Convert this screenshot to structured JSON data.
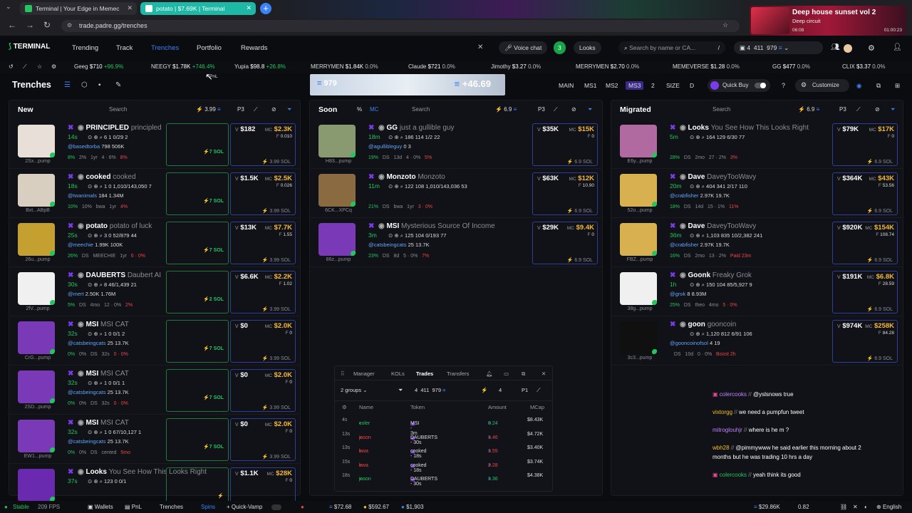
{
  "browser": {
    "tabs": [
      {
        "title": "Terminal | Your Edge in Memec",
        "active": false
      },
      {
        "title": "potato | $7.69K | Terminal",
        "active": true
      }
    ],
    "url": "trade.padre.gg/trenches",
    "media": {
      "title": "Deep house sunset vol 2",
      "artist": "Deep circuit",
      "elapsed": "06:08",
      "duration": "01:00:23"
    }
  },
  "nav": {
    "logo": "TERMINAL",
    "links": [
      "Trending",
      "Track",
      "Trenches",
      "Portfolio",
      "Rewards"
    ],
    "active": "Trenches",
    "voice_chat": "Voice chat",
    "looks_count": "3",
    "looks_label": "Looks",
    "search_placeholder": "Search by name or CA...",
    "search_shortcut": "/",
    "wallet": {
      "count": "4",
      "v1": "411",
      "v2": "979"
    }
  },
  "ticker": [
    {
      "name": "Geeg",
      "mc": "$710",
      "change": "+96.9%"
    },
    {
      "name": "NEEGY",
      "mc": "$1.78K",
      "change": "+746.4%"
    },
    {
      "name": "Yupia",
      "mc": "$98.8",
      "change": "+26.8%"
    },
    {
      "name": "MERRYMEN",
      "mc": "$1.84K",
      "change": "0.0%"
    },
    {
      "name": "Claude",
      "mc": "$721",
      "change": "0.0%"
    },
    {
      "name": "Jimothy",
      "mc": "$3.27",
      "change": "0.0%"
    },
    {
      "name": "MERRYMEN",
      "mc": "$2.70",
      "change": "0.0%"
    },
    {
      "name": "MEMEVERSE",
      "mc": "$1.28",
      "change": "0.0%"
    },
    {
      "name": "GG",
      "mc": "$477",
      "change": "0.0%"
    },
    {
      "name": "CLIX",
      "mc": "$3.37",
      "change": "0.0%"
    }
  ],
  "toolbar": {
    "title": "Trenches",
    "pnl_left": "979",
    "pnl_right": "+46.69",
    "pnl_tooltip": "PnL",
    "presets": [
      "MAIN",
      "MS1",
      "MS2",
      "MS3"
    ],
    "active_preset": "MS3",
    "size_label": "SIZE",
    "size_val": "2",
    "d_label": "D",
    "quick_buy": "Quick Buy",
    "customize": "Customize"
  },
  "columns": [
    {
      "title": "New",
      "search": "Search",
      "amount": "3.99",
      "preset": "P3",
      "cards": [
        {
          "name": "PRINCIPLED",
          "sub": "principled",
          "age": "14s",
          "r2": "6  1  0/29  2",
          "handle": "@basedtorba",
          "r3": "798  506K",
          "r4": [
            "8%",
            "2%",
            "1yr",
            "4 · 6%",
            "8%"
          ],
          "v": "$182",
          "mc": "$2.3K",
          "f": "0.010",
          "sol": "3.99 SOL",
          "g": "7 SOL",
          "addr": "2Sx...pump",
          "avc": "#e8e0d8"
        },
        {
          "name": "cooked",
          "sub": "cooked",
          "age": "18s",
          "r2": "1  0  1,010/143,050  7",
          "handle": "@twanimals",
          "r3": "184  1.34M",
          "r4": [
            "10%",
            "10%",
            "bwa",
            "1yr",
            "4%"
          ],
          "v": "$1.5K",
          "mc": "$2.5K",
          "f": "0.026",
          "sol": "3.99 SOL",
          "g": "7 SOL",
          "addr": "Bxt...ABpB",
          "avc": "#d8cfc0"
        },
        {
          "name": "potato",
          "sub": "potato of luck",
          "age": "25s",
          "r2": "3  0  52/879  44",
          "handle": "@meechie",
          "r3": "1.99K  100K",
          "r4": [
            "26%",
            "DS",
            "MEECHIE",
            "1yr",
            "6 · 0%"
          ],
          "v": "$13K",
          "mc": "$7.7K",
          "f": "1.55",
          "sol": "3.99 SOL",
          "g": "7 SOL",
          "addr": "26u...pump",
          "avc": "#c4a030"
        },
        {
          "name": "DAUBERTS",
          "sub": "Daubert AI",
          "age": "30s",
          "r2": "8  46/1,439  21",
          "handle": "@mert",
          "r3": "2.50K  1.76M",
          "r4": [
            "5%",
            "DS",
            "4mo",
            "12 · 0%",
            "2%"
          ],
          "v": "$6.6K",
          "mc": "$2.2K",
          "f": "1.02",
          "sol": "3.99 SOL",
          "g": "2 SOL",
          "addr": "2fV...pump",
          "avc": "#f0f0f0"
        },
        {
          "name": "MSI",
          "sub": "MSI CAT",
          "age": "32s",
          "r2": "1  0  0/1  2",
          "handle": "@catsbeingcats",
          "r3": "25  13.7K",
          "r4": [
            "0%",
            "0%",
            "DS",
            "32s",
            "0 · 0%"
          ],
          "v": "$0",
          "mc": "$2.0K",
          "f": "0",
          "sol": "3.99 SOL",
          "g": "7 SOL",
          "addr": "CrG...pump",
          "avc": "#7a3ab8"
        },
        {
          "name": "MSI",
          "sub": "MSI CAT",
          "age": "32s",
          "r2": "1  0  0/1  1",
          "handle": "@catsbeingcats",
          "r3": "25  13.7K",
          "r4": [
            "0%",
            "0%",
            "DS",
            "32s",
            "0 · 0%"
          ],
          "v": "$0",
          "mc": "$2.0K",
          "f": "0",
          "sol": "3.99 SOL",
          "g": "7 SOL",
          "addr": "2SD...pump",
          "avc": "#7a3ab8"
        },
        {
          "name": "MSI",
          "sub": "MSI CAT",
          "age": "32s",
          "r2": "1  0  67/10,127  1",
          "handle": "@catsbeingcats",
          "r3": "25  13.7K",
          "r4": [
            "0%",
            "0%",
            "DS",
            "cented",
            "5mo"
          ],
          "v": "$0",
          "mc": "$2.0K",
          "f": "0",
          "sol": "3.99 SOL",
          "g": "7 SOL",
          "addr": "EW1...pump",
          "avc": "#7a3ab8"
        },
        {
          "name": "Looks",
          "sub": "You See How This Looks Right",
          "age": "37s",
          "r2": "123  0  0/1",
          "handle": "",
          "r3": "",
          "r4": [
            "",
            "",
            "",
            "",
            ""
          ],
          "v": "$1.1K",
          "mc": "$28K",
          "f": "0",
          "sol": "",
          "g": "",
          "addr": "",
          "avc": "#6a2ab0"
        }
      ]
    },
    {
      "title": "Soon",
      "search": "Search",
      "amount": "6.9",
      "preset": "P3",
      "cards": [
        {
          "name": "GG",
          "sub": "just a gullible guy",
          "age": "18m",
          "r2": "186  114  1/2  22",
          "handle": "@agullibleguy",
          "r3": "0  3",
          "r4": [
            "19%",
            "DS",
            "13d",
            "4 · 0%",
            "5%"
          ],
          "v": "$35K",
          "mc": "$15K",
          "f": "0",
          "sol": "6.9 SOL",
          "g": "",
          "addr": "H83...pump",
          "avc": "#8a9a70"
        },
        {
          "name": "Monzoto",
          "sub": "Monzoto",
          "age": "11m",
          "r2": "122  108  1,010/143,036  53",
          "handle": "",
          "r3": "",
          "r4": [
            "21%",
            "DS",
            "bwa",
            "1yr",
            "3 · 0%"
          ],
          "v": "$63K",
          "mc": "$12K",
          "f": "10.90",
          "sol": "6.9 SOL",
          "g": "",
          "addr": "6CK...XPCq",
          "avc": "#8a6a40"
        },
        {
          "name": "MSI",
          "sub": "Mysterious Source Of Income",
          "age": "3m",
          "r2": "125  104  0/193  77",
          "handle": "@catsbeingcats",
          "r3": "25  13.7K",
          "r4": [
            "23%",
            "DS",
            "8d",
            "5 · 0%",
            "7%"
          ],
          "v": "$29K",
          "mc": "$9.4K",
          "f": "0",
          "sol": "6.9 SOL",
          "g": "",
          "addr": "86z...pump",
          "avc": "#7a3ab8"
        }
      ]
    },
    {
      "title": "Migrated",
      "search": "Search",
      "amount": "6.9",
      "preset": "P3",
      "cards": [
        {
          "name": "Looks",
          "sub": "You See How This Looks Right",
          "age": "5m",
          "r2": "164  129  6/30  77",
          "handle": "",
          "r3": "",
          "r4": [
            "28%",
            "DS",
            "2mo",
            "27 · 2%",
            "3%"
          ],
          "v": "$79K",
          "mc": "$17K",
          "f": "0",
          "sol": "6.9 SOL",
          "g": "",
          "addr": "E6y...pump",
          "avc": "#b06aa0"
        },
        {
          "name": "Dave",
          "sub": "DaveyTooWavy",
          "age": "20m",
          "r2": "404  341  2/17  110",
          "handle": "@crabfisher",
          "r3": "2.97K  19.7K",
          "r4": [
            "18%",
            "DS",
            "14d",
            "15 · 1%",
            "11%"
          ],
          "v": "$364K",
          "mc": "$43K",
          "f": "53.56",
          "sol": "6.9 SOL",
          "g": "",
          "addr": "52o...pump",
          "avc": "#d8b050"
        },
        {
          "name": "Dave",
          "sub": "DaveyTooWavy",
          "age": "36m",
          "r2": "1,103  835  10/2,382  241",
          "handle": "@crabfisher",
          "r3": "2.97K  19.7K",
          "r4": [
            "16%",
            "DS",
            "2mo",
            "13 · 2%",
            "Paid 23m"
          ],
          "v": "$920K",
          "mc": "$154K",
          "f": "108.74",
          "sol": "6.9 SOL",
          "g": "",
          "addr": "FBZ...pump",
          "avc": "#d8b050"
        },
        {
          "name": "Goonk",
          "sub": "Freaky Grok",
          "age": "1h",
          "r2": "150  104  85/5,927  9",
          "handle": "@grok",
          "r3": "8  8.93M",
          "r4": [
            "25%",
            "DS",
            "theo",
            "4mo",
            "5 · 0%"
          ],
          "v": "$191K",
          "mc": "$6.8K",
          "f": "28.59",
          "sol": "6.9 SOL",
          "g": "",
          "addr": "38g...pump",
          "avc": "#f0f0f0"
        },
        {
          "name": "goon",
          "sub": "gooncoin",
          "age": "",
          "r2": "1,120  812  6/91  106",
          "handle": "@gooncoinofsol",
          "r3": "4  19",
          "r4": [
            "",
            "DS",
            "10d",
            "0 · 0%",
            "Boost 2h"
          ],
          "v": "$974K",
          "mc": "$258K",
          "f": "84.28",
          "sol": "6.9 SOL",
          "g": "",
          "addr": "3c3...pump",
          "avc": "#101010"
        }
      ]
    }
  ],
  "trades_panel": {
    "tabs": [
      "Manager",
      "KOLs",
      "Trades",
      "Transfers"
    ],
    "active_tab": "Trades",
    "groups": "2 groups",
    "count": "4",
    "v1": "411",
    "v2": "979",
    "v3": "4",
    "preset": "P1",
    "headers": [
      "Name",
      "Token",
      "Amount",
      "MCap"
    ],
    "rows": [
      {
        "age": "4s",
        "name": "coler",
        "token": "MSI - 3m",
        "amount": "0.24",
        "mcap": "$8.43K",
        "buy": true
      },
      {
        "age": "13s",
        "name": "jason",
        "token": "DAUBERTS - 30s",
        "amount": "1.46",
        "mcap": "$4.72K",
        "buy": false
      },
      {
        "age": "13s",
        "name": "bwa",
        "token": "cooked - 18s",
        "amount": "1.55",
        "mcap": "$3.40K",
        "buy": false
      },
      {
        "age": "15s",
        "name": "bwa",
        "token": "cooked - 18s",
        "amount": "2.28",
        "mcap": "$3.74K",
        "buy": false
      },
      {
        "age": "18s",
        "name": "jason",
        "token": "DAUBERTS - 30s",
        "amount": "1.36",
        "mcap": "$4.38K",
        "buy": true
      }
    ]
  },
  "chat": [
    {
      "user": "colercooks",
      "msg": "@yslsnows true"
    },
    {
      "user": "vixtorgg",
      "msg": "we need a pumpfun tweet"
    },
    {
      "user": "mitroglouhjr",
      "msg": "where is he m ?"
    },
    {
      "user": "wbh28",
      "msg": "@pimmywww he said earlier this morning about 2"
    },
    {
      "user": "",
      "msg": "months but he was trading 10 hrs a day"
    },
    {
      "user": "colercooks",
      "msg": "yeah think its good"
    }
  ],
  "statusbar": {
    "stable": "Stable",
    "fps": "209 FPS",
    "wallets": "Wallets",
    "pnl": "PnL",
    "trenches": "Trenches",
    "spins": "Spins",
    "quickvamp": "Quick-Vamp",
    "p1": "$72.68",
    "p2": "$592.67",
    "p3": "$1,903",
    "right1": "$29.86K",
    "right2": "0.82",
    "lang": "English"
  },
  "colors": {
    "green": "#22c55e",
    "red": "#ef4444",
    "blue": "#3b82f6",
    "gold": "#f5b93a",
    "purple": "#7c3aed"
  }
}
